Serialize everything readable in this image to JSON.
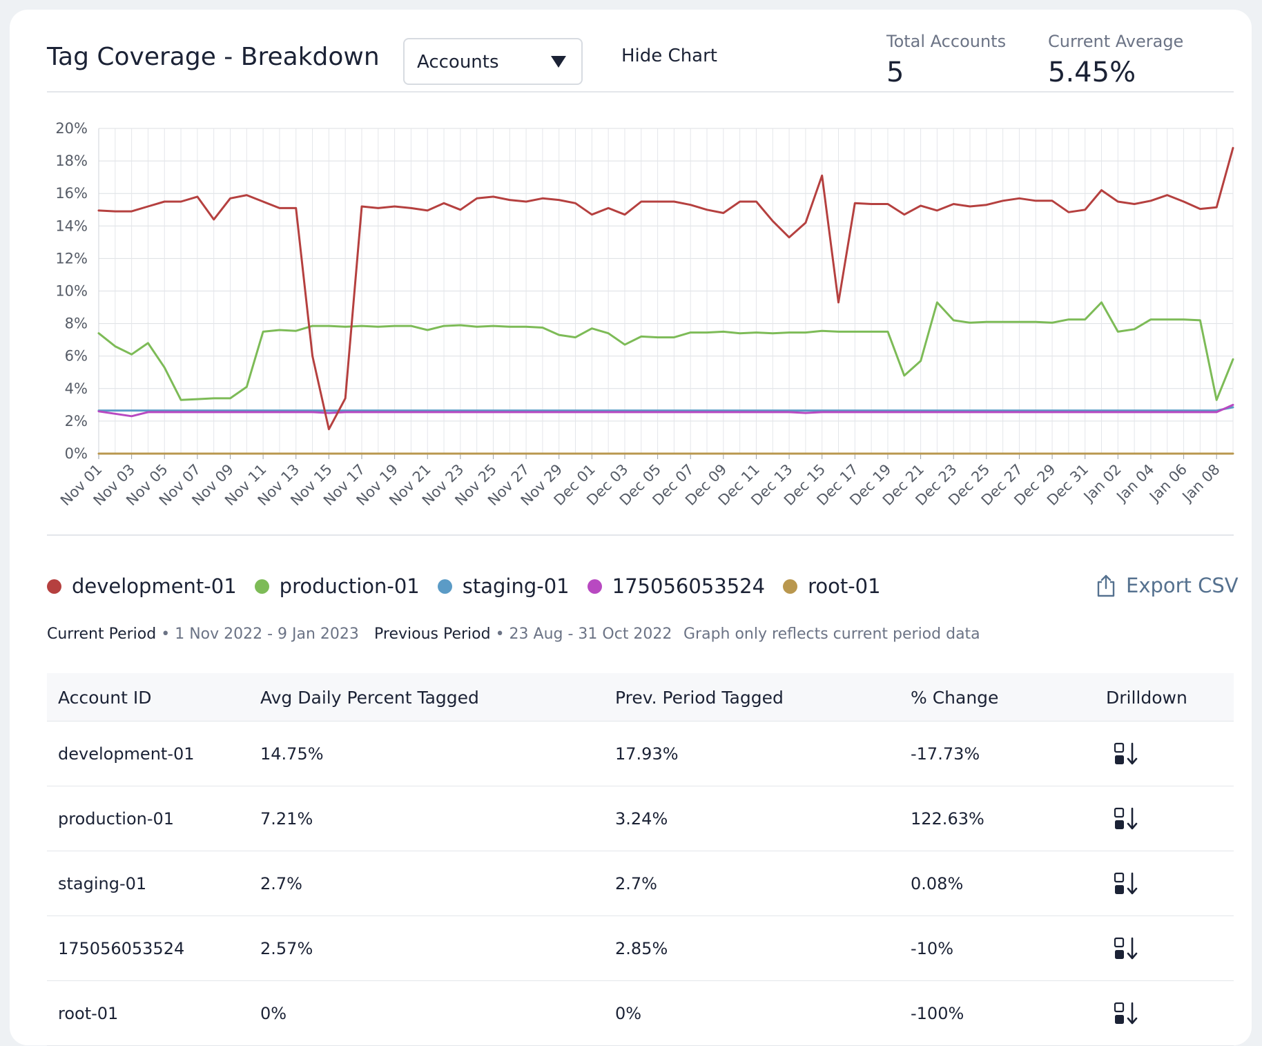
{
  "header": {
    "title": "Tag Coverage - Breakdown",
    "dropdown_value": "Accounts",
    "hide_chart_label": "Hide Chart",
    "kpis": [
      {
        "label": "Total Accounts",
        "value": "5"
      },
      {
        "label": "Current Average",
        "value": "5.45%"
      }
    ]
  },
  "chart_data": {
    "type": "line",
    "title": "",
    "xlabel": "",
    "ylabel": "",
    "ylim": [
      0,
      20
    ],
    "y_ticks": [
      "0%",
      "2%",
      "4%",
      "6%",
      "8%",
      "10%",
      "12%",
      "14%",
      "16%",
      "18%",
      "20%"
    ],
    "grid": true,
    "legend_position": "below",
    "x_tick_labels": [
      "Nov 01",
      "Nov 03",
      "Nov 05",
      "Nov 07",
      "Nov 09",
      "Nov 11",
      "Nov 13",
      "Nov 15",
      "Nov 17",
      "Nov 19",
      "Nov 21",
      "Nov 23",
      "Nov 25",
      "Nov 27",
      "Nov 29",
      "Dec 01",
      "Dec 03",
      "Dec 05",
      "Dec 07",
      "Dec 09",
      "Dec 11",
      "Dec 13",
      "Dec 15",
      "Dec 17",
      "Dec 19",
      "Dec 21",
      "Dec 23",
      "Dec 25",
      "Dec 27",
      "Dec 29",
      "Dec 31",
      "Jan 02",
      "Jan 04",
      "Jan 06",
      "Jan 08"
    ],
    "x": [
      "Nov 01",
      "Nov 02",
      "Nov 03",
      "Nov 04",
      "Nov 05",
      "Nov 06",
      "Nov 07",
      "Nov 08",
      "Nov 09",
      "Nov 10",
      "Nov 11",
      "Nov 12",
      "Nov 13",
      "Nov 14",
      "Nov 15",
      "Nov 16",
      "Nov 17",
      "Nov 18",
      "Nov 19",
      "Nov 20",
      "Nov 21",
      "Nov 22",
      "Nov 23",
      "Nov 24",
      "Nov 25",
      "Nov 26",
      "Nov 27",
      "Nov 28",
      "Nov 29",
      "Nov 30",
      "Dec 01",
      "Dec 02",
      "Dec 03",
      "Dec 04",
      "Dec 05",
      "Dec 06",
      "Dec 07",
      "Dec 08",
      "Dec 09",
      "Dec 10",
      "Dec 11",
      "Dec 12",
      "Dec 13",
      "Dec 14",
      "Dec 15",
      "Dec 16",
      "Dec 17",
      "Dec 18",
      "Dec 19",
      "Dec 20",
      "Dec 21",
      "Dec 22",
      "Dec 23",
      "Dec 24",
      "Dec 25",
      "Dec 26",
      "Dec 27",
      "Dec 28",
      "Dec 29",
      "Dec 30",
      "Dec 31",
      "Jan 01",
      "Jan 02",
      "Jan 03",
      "Jan 04",
      "Jan 05",
      "Jan 06",
      "Jan 07",
      "Jan 08",
      "Jan 09"
    ],
    "series": [
      {
        "name": "development-01",
        "color": "#b5403f",
        "values": [
          14.95,
          14.9,
          14.9,
          15.2,
          15.5,
          15.5,
          15.8,
          14.4,
          15.7,
          15.9,
          15.5,
          15.1,
          15.1,
          6.0,
          1.5,
          3.4,
          15.2,
          15.1,
          15.2,
          15.1,
          14.95,
          15.4,
          15.0,
          15.7,
          15.8,
          15.6,
          15.5,
          15.7,
          15.6,
          15.4,
          14.7,
          15.1,
          14.7,
          15.5,
          15.5,
          15.5,
          15.3,
          15.0,
          14.8,
          15.5,
          15.5,
          14.3,
          13.3,
          14.2,
          17.1,
          9.3,
          15.4,
          15.35,
          15.35,
          14.7,
          15.25,
          14.95,
          15.35,
          15.2,
          15.3,
          15.55,
          15.7,
          15.55,
          15.55,
          14.85,
          15.0,
          16.2,
          15.5,
          15.35,
          15.55,
          15.9,
          15.5,
          15.05,
          15.15,
          18.8
        ]
      },
      {
        "name": "production-01",
        "color": "#7dbb57",
        "values": [
          7.4,
          6.6,
          6.1,
          6.8,
          5.3,
          3.3,
          3.35,
          3.4,
          3.4,
          4.1,
          7.5,
          7.6,
          7.55,
          7.85,
          7.85,
          7.8,
          7.85,
          7.8,
          7.85,
          7.85,
          7.6,
          7.85,
          7.9,
          7.8,
          7.85,
          7.8,
          7.8,
          7.75,
          7.3,
          7.15,
          7.7,
          7.4,
          6.7,
          7.2,
          7.15,
          7.15,
          7.45,
          7.45,
          7.5,
          7.4,
          7.45,
          7.4,
          7.45,
          7.45,
          7.55,
          7.5,
          7.5,
          7.5,
          7.5,
          4.8,
          5.7,
          9.3,
          8.2,
          8.05,
          8.1,
          8.1,
          8.1,
          8.1,
          8.05,
          8.25,
          8.25,
          9.3,
          7.5,
          7.65,
          8.25,
          8.25,
          8.25,
          8.2,
          3.3,
          5.8
        ]
      },
      {
        "name": "staging-01",
        "color": "#5b9bc6",
        "values": [
          2.65,
          2.65,
          2.65,
          2.65,
          2.65,
          2.65,
          2.65,
          2.65,
          2.65,
          2.65,
          2.65,
          2.65,
          2.65,
          2.65,
          2.65,
          2.65,
          2.65,
          2.65,
          2.65,
          2.65,
          2.65,
          2.65,
          2.65,
          2.65,
          2.65,
          2.65,
          2.65,
          2.65,
          2.65,
          2.65,
          2.65,
          2.65,
          2.65,
          2.65,
          2.65,
          2.65,
          2.65,
          2.65,
          2.65,
          2.65,
          2.65,
          2.65,
          2.65,
          2.65,
          2.65,
          2.65,
          2.65,
          2.65,
          2.65,
          2.65,
          2.65,
          2.65,
          2.65,
          2.65,
          2.65,
          2.65,
          2.65,
          2.65,
          2.65,
          2.65,
          2.65,
          2.65,
          2.65,
          2.65,
          2.65,
          2.65,
          2.65,
          2.65,
          2.65,
          2.85
        ]
      },
      {
        "name": "175056053524",
        "color": "#b849c1",
        "values": [
          2.6,
          2.45,
          2.3,
          2.55,
          2.55,
          2.55,
          2.55,
          2.55,
          2.55,
          2.55,
          2.55,
          2.55,
          2.55,
          2.55,
          2.5,
          2.55,
          2.55,
          2.55,
          2.55,
          2.55,
          2.55,
          2.55,
          2.55,
          2.55,
          2.55,
          2.55,
          2.55,
          2.55,
          2.55,
          2.55,
          2.55,
          2.55,
          2.55,
          2.55,
          2.55,
          2.55,
          2.55,
          2.55,
          2.55,
          2.55,
          2.55,
          2.55,
          2.55,
          2.5,
          2.55,
          2.55,
          2.55,
          2.55,
          2.55,
          2.55,
          2.55,
          2.55,
          2.55,
          2.55,
          2.55,
          2.55,
          2.55,
          2.55,
          2.55,
          2.55,
          2.55,
          2.55,
          2.55,
          2.55,
          2.55,
          2.55,
          2.55,
          2.55,
          2.55,
          3.0
        ]
      },
      {
        "name": "root-01",
        "color": "#b9974e",
        "values": [
          0,
          0,
          0,
          0,
          0,
          0,
          0,
          0,
          0,
          0,
          0,
          0,
          0,
          0,
          0,
          0,
          0,
          0,
          0,
          0,
          0,
          0,
          0,
          0,
          0,
          0,
          0,
          0,
          0,
          0,
          0,
          0,
          0,
          0,
          0,
          0,
          0,
          0,
          0,
          0,
          0,
          0,
          0,
          0,
          0,
          0,
          0,
          0,
          0,
          0,
          0,
          0,
          0,
          0,
          0,
          0,
          0,
          0,
          0,
          0,
          0,
          0,
          0,
          0,
          0,
          0,
          0,
          0,
          0,
          0
        ]
      }
    ]
  },
  "export_label": "Export CSV",
  "export_icon": "share-upload-icon",
  "periods": {
    "current_label": "Current Period",
    "current_range": "1 Nov 2022 - 9 Jan 2023",
    "previous_label": "Previous Period",
    "previous_range": "23 Aug - 31 Oct 2022",
    "note": "Graph only reflects current period data",
    "separator": " • "
  },
  "table": {
    "columns": [
      "Account ID",
      "Avg Daily Percent Tagged",
      "Prev. Period Tagged",
      "% Change",
      "Drilldown"
    ],
    "rows": [
      {
        "id": "development-01",
        "avg": "14.75%",
        "prev": "17.93%",
        "change": "-17.73%"
      },
      {
        "id": "production-01",
        "avg": "7.21%",
        "prev": "3.24%",
        "change": "122.63%"
      },
      {
        "id": "staging-01",
        "avg": "2.7%",
        "prev": "2.7%",
        "change": "0.08%"
      },
      {
        "id": "175056053524",
        "avg": "2.57%",
        "prev": "2.85%",
        "change": "-10%"
      },
      {
        "id": "root-01",
        "avg": "0%",
        "prev": "0%",
        "change": "-100%"
      }
    ],
    "drill_icon": "drilldown-icon"
  }
}
